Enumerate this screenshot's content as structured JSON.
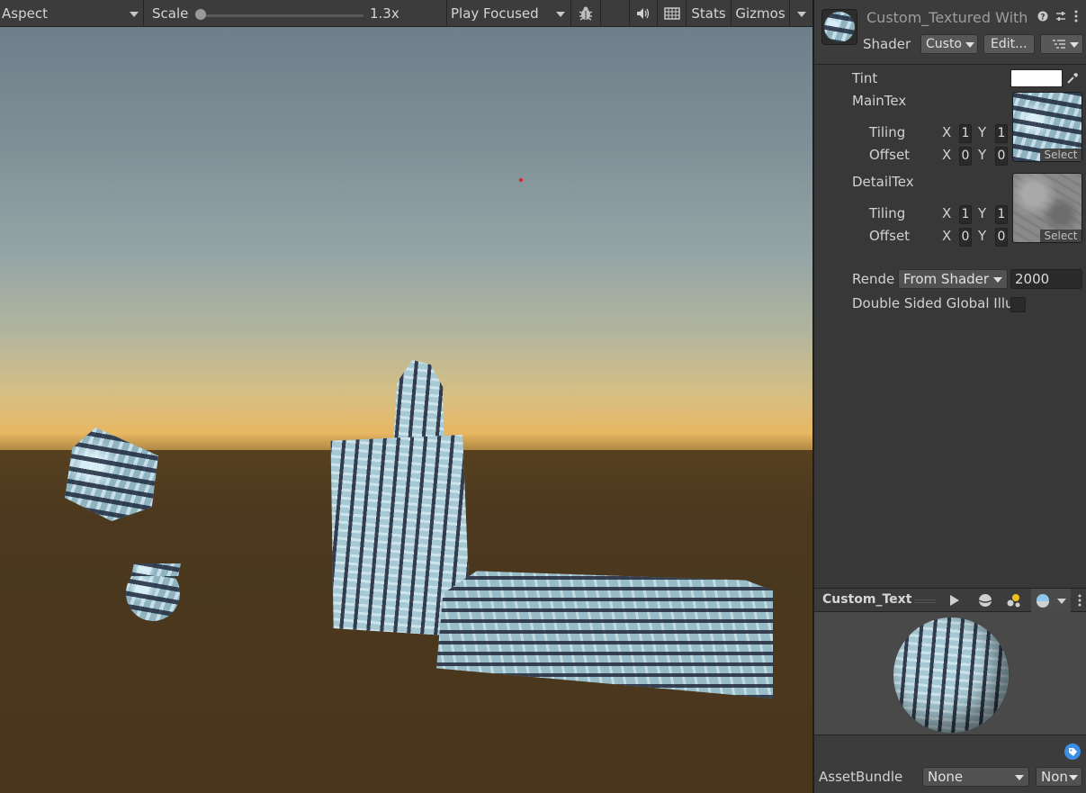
{
  "toolbar": {
    "aspect": "Aspect",
    "scale_label": "Scale",
    "scale_value": "1.3x",
    "scale_fraction": 0.0,
    "play_focused": "Play Focused",
    "stats": "Stats",
    "gizmos": "Gizmos"
  },
  "inspector": {
    "title": "Custom_Textured With",
    "shader_label": "Shader",
    "shader_value": "Custo",
    "edit_button": "Edit...",
    "tint_label": "Tint",
    "tint_color": "#ffffff",
    "main_tex": {
      "label": "MainTex",
      "tiling_label": "Tiling",
      "offset_label": "Offset",
      "tiling_x": "1",
      "tiling_y": "1",
      "offset_x": "0",
      "offset_y": "0",
      "select": "Select"
    },
    "detail_tex": {
      "label": "DetailTex",
      "tiling_label": "Tiling",
      "offset_label": "Offset",
      "tiling_x": "1",
      "tiling_y": "1",
      "offset_x": "0",
      "offset_y": "0",
      "select": "Select"
    },
    "x_label": "X",
    "y_label": "Y",
    "render_queue_label": "Rende",
    "render_queue_mode": "From Shader",
    "render_queue_value": "2000",
    "double_sided_label": "Double Sided Global Illu",
    "double_sided_checked": false
  },
  "preview": {
    "title": "Custom_Text"
  },
  "asset_bundle": {
    "label": "AssetBundle",
    "name_value": "None",
    "variant_value": "Non"
  },
  "colors": {
    "accent_tag": "#3a8ee6",
    "bg": "#383838"
  }
}
